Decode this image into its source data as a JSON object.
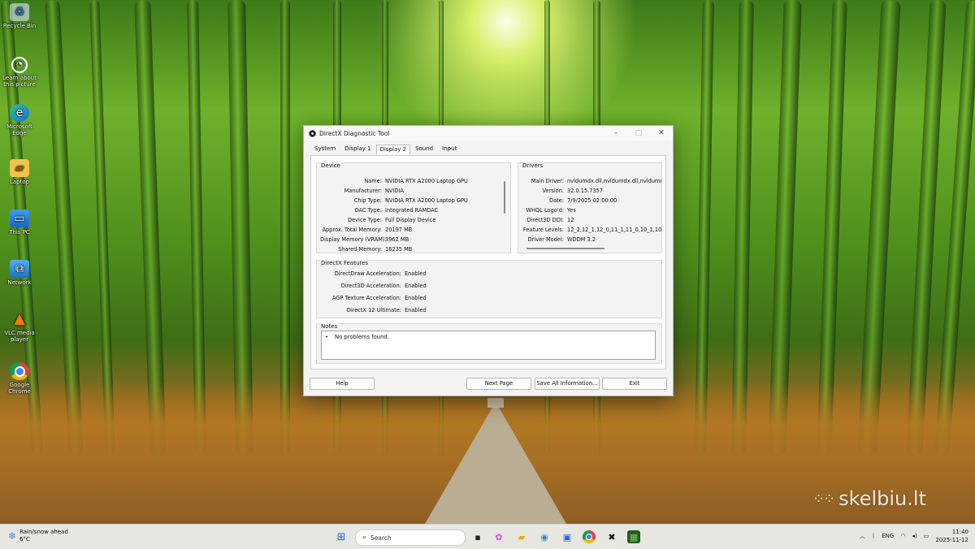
{
  "desktop": {
    "icons": [
      {
        "label": "Recycle Bin",
        "icon": "recycle-bin-icon"
      },
      {
        "label": "Learn about this picture",
        "icon": "camera-icon"
      },
      {
        "label": "Microsoft Edge",
        "icon": "edge-icon"
      },
      {
        "label": "Laptop",
        "icon": "folder-icon"
      },
      {
        "label": "This PC",
        "icon": "monitor-icon"
      },
      {
        "label": "Network",
        "icon": "network-icon"
      },
      {
        "label": "VLC media player",
        "icon": "vlc-icon"
      },
      {
        "label": "Google Chrome",
        "icon": "chrome-icon"
      }
    ]
  },
  "dialog": {
    "title": "DirectX Diagnostic Tool",
    "tabs": [
      "System",
      "Display 1",
      "Display 2",
      "Sound",
      "Input"
    ],
    "active_tab": "Display 2",
    "device": {
      "label": "Device",
      "rows": [
        {
          "k": "Name:",
          "v": "NVIDIA RTX A2000 Laptop GPU"
        },
        {
          "k": "Manufacturer:",
          "v": "NVIDIA"
        },
        {
          "k": "Chip Type:",
          "v": "NVIDIA RTX A2000 Laptop GPU"
        },
        {
          "k": "DAC Type:",
          "v": "Integrated RAMDAC"
        },
        {
          "k": "Device Type:",
          "v": "Full Display Device"
        },
        {
          "k": "Approx. Total Memory:",
          "v": "20197 MB"
        },
        {
          "k": "Display Memory (VRAM):",
          "v": "3962 MB"
        },
        {
          "k": "Shared Memory:",
          "v": "16235 MB"
        }
      ]
    },
    "drivers": {
      "label": "Drivers",
      "rows": [
        {
          "k": "Main Driver:",
          "v": "nvldumdx.dll,nvldumdx.dll,nvldumdx.d"
        },
        {
          "k": "Version:",
          "v": "32.0.15.7357"
        },
        {
          "k": "Date:",
          "v": "7/9/2025 02:00:00"
        },
        {
          "k": "WHQL Logo'd:",
          "v": "Yes"
        },
        {
          "k": "Direct3D DDI:",
          "v": "12"
        },
        {
          "k": "Feature Levels:",
          "v": "12_2,12_1,12_0,11_1,11_0,10_1,10_"
        },
        {
          "k": "Driver Model:",
          "v": "WDDM 3.2"
        }
      ]
    },
    "features": {
      "label": "DirectX Features",
      "rows": [
        {
          "k": "DirectDraw Acceleration:",
          "v": "Enabled"
        },
        {
          "k": "Direct3D Acceleration:",
          "v": "Enabled"
        },
        {
          "k": "AGP Texture Acceleration:",
          "v": "Enabled"
        },
        {
          "k": "DirectX 12 Ultimate:",
          "v": "Enabled"
        }
      ]
    },
    "notes": {
      "label": "Notes",
      "bullet": "•",
      "text": "No problems found."
    },
    "buttons": {
      "help": "Help",
      "next_page": "Next Page",
      "save_all": "Save All Information...",
      "exit": "Exit"
    }
  },
  "taskbar": {
    "weather_line1": "Rain/snow ahead",
    "weather_line2": "6°C",
    "search_placeholder": "Search",
    "language": "ENG",
    "time": "11:40",
    "date": "2025-11-12"
  },
  "watermark": "skelbiu.lt"
}
